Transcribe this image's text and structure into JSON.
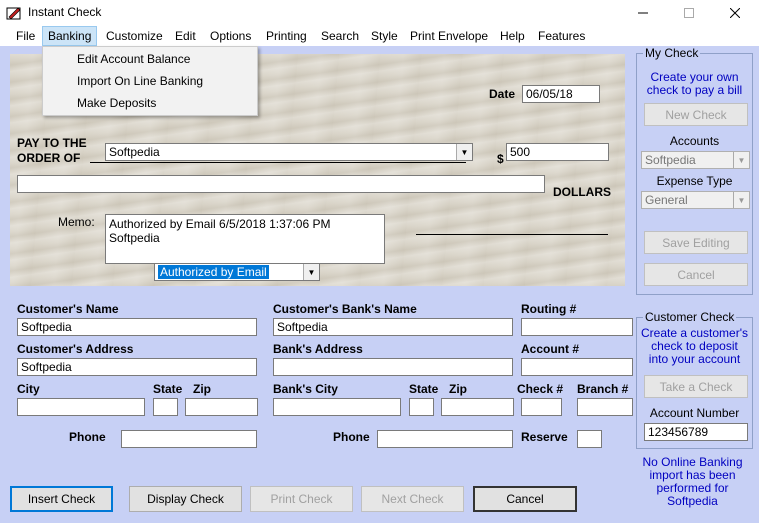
{
  "window": {
    "title": "Instant Check"
  },
  "menu": [
    "File",
    "Banking",
    "Customize",
    "Edit",
    "Options",
    "Printing",
    "Search",
    "Style",
    "Print Envelope",
    "Help",
    "Features"
  ],
  "banking_menu": [
    "Edit Account Balance",
    "Import On Line Banking",
    "Make Deposits"
  ],
  "check": {
    "date_label": "Date",
    "date_value": "06/05/18",
    "pay_to_line1": "PAY TO THE",
    "pay_to_line2": "ORDER OF",
    "payee": "Softpedia",
    "dollar_sign": "$",
    "amount": "500",
    "amount_words": "",
    "dollars_label": "DOLLARS",
    "memo_label": "Memo:",
    "memo_line1": "Authorized by Email 6/5/2018 1:37:06 PM",
    "memo_line2": "Softpedia",
    "authorization": "Authorized by Email"
  },
  "customer": {
    "name_label": "Customer's Name",
    "name": "Softpedia",
    "address_label": "Customer's Address",
    "address": "Softpedia",
    "city_label": "City",
    "city": "",
    "state_label": "State",
    "state": "",
    "zip_label": "Zip",
    "zip": "",
    "phone_label": "Phone",
    "phone": ""
  },
  "bank": {
    "name_label": "Customer's Bank's Name",
    "name": "Softpedia",
    "address_label": "Bank's Address",
    "address": "",
    "city_label": "Bank's City",
    "city": "",
    "state_label": "State",
    "state": "",
    "zip_label": "Zip",
    "zip": "",
    "phone_label": "Phone",
    "phone": ""
  },
  "routing": {
    "routing_label": "Routing #",
    "routing": "",
    "account_label": "Account #",
    "account": "",
    "check_label": "Check #",
    "check": "",
    "branch_label": "Branch #",
    "branch": "",
    "reserve_label": "Reserve",
    "reserve": ""
  },
  "my_check": {
    "title": "My Check",
    "desc": "Create your own check to pay a bill",
    "new_check": "New Check",
    "accounts_label": "Accounts",
    "accounts_value": "Softpedia",
    "expense_label": "Expense Type",
    "expense_value": "General",
    "save_editing": "Save Editing",
    "cancel": "Cancel"
  },
  "customer_check": {
    "title": "Customer Check",
    "desc": "Create a customer's check to deposit into your account",
    "take_check": "Take a Check",
    "account_number_label": "Account Number",
    "account_number": "123456789",
    "online_note": "No Online Banking import has been performed for Softpedia"
  },
  "buttons": {
    "insert_check": "Insert Check",
    "display_check": "Display Check",
    "print_check": "Print Check",
    "next_check": "Next Check",
    "cancel": "Cancel"
  }
}
